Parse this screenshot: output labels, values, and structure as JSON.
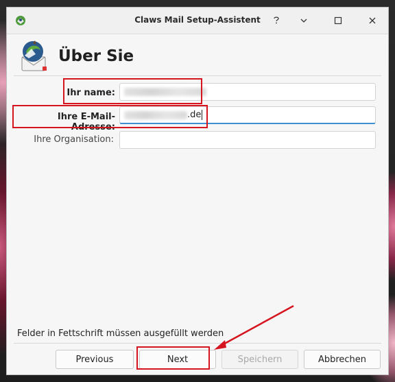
{
  "window": {
    "title": "Claws Mail Setup-Assistent"
  },
  "page": {
    "heading": "Über Sie"
  },
  "fields": {
    "name_label": "Ihr name:",
    "email_label": "Ihre E-Mail-Adresse:",
    "email_visible_suffix": ".de",
    "org_label": "Ihre Organisation:",
    "org_value": ""
  },
  "footer": {
    "note": "Felder in Fettschrift müssen ausgefüllt werden"
  },
  "buttons": {
    "previous": "Previous",
    "next": "Next",
    "save": "Speichern",
    "cancel": "Abbrechen"
  },
  "annotations": {
    "highlight_color": "#d6141f"
  },
  "icons": {
    "title": "claws-mail-icon",
    "header": "claws-mail-logo-icon",
    "help": "help-icon",
    "minimize": "minimize-icon",
    "maximize": "maximize-icon",
    "close": "close-icon"
  }
}
